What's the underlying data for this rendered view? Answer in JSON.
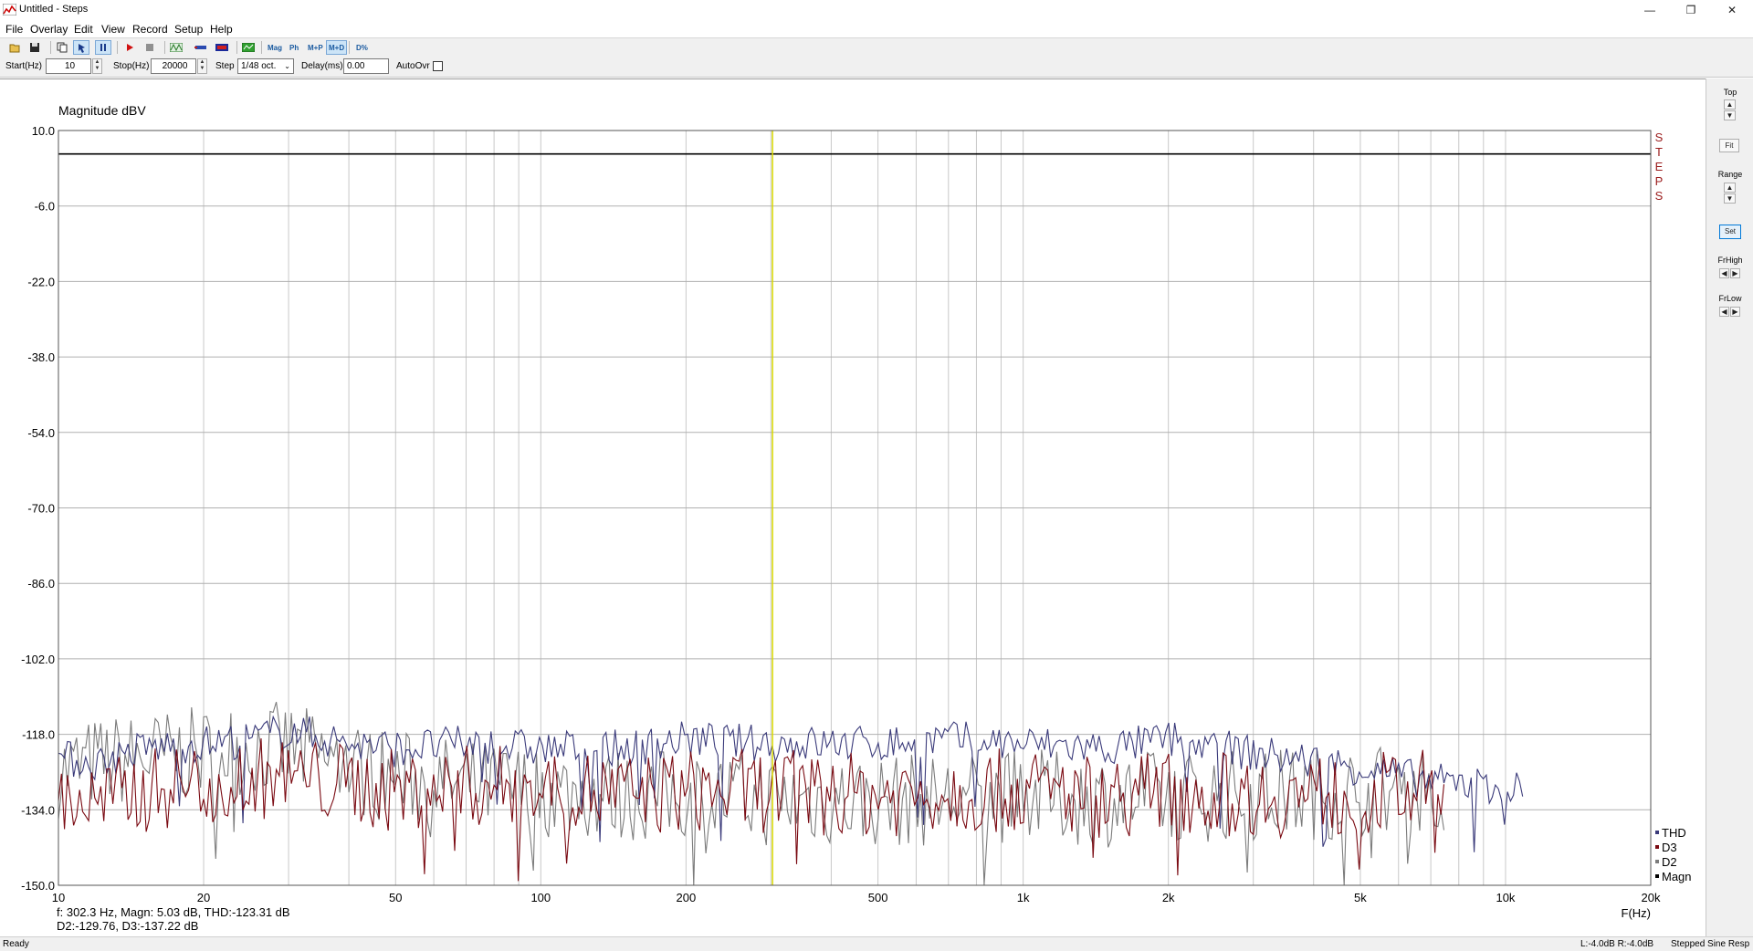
{
  "window": {
    "title": "Untitled - Steps",
    "minimize": "—",
    "restore": "❐",
    "close": "✕"
  },
  "menu": [
    "File",
    "Overlay",
    "Edit",
    "View",
    "Record",
    "Setup",
    "Help"
  ],
  "toolbar": {
    "buttons": [
      "open-icon",
      "save-icon",
      "copy-icon",
      "cursor-icon",
      "pause-icon",
      "play-icon",
      "stop-icon",
      "sweep-icon",
      "loop-icon",
      "generator-icon",
      "spectrum-icon"
    ],
    "mode_buttons": [
      "Mag",
      "Ph",
      "M+P",
      "M+D",
      "D%"
    ],
    "active_mode": "M+D"
  },
  "controls": {
    "start_label": "Start(Hz)",
    "start_value": "10",
    "stop_label": "Stop(Hz)",
    "stop_value": "20000",
    "step_label": "Step",
    "step_value": "1/48 oct.",
    "delay_label": "Delay(ms)",
    "delay_value": "0.00",
    "autoovr_label": "AutoOvr"
  },
  "right_panel": {
    "top_label": "Top",
    "fit_label": "Fit",
    "range_label": "Range",
    "set_label": "Set",
    "frhigh_label": "FrHigh",
    "frlow_label": "FrLow",
    "up": "▲",
    "down": "▼",
    "left": "◀",
    "right": "▶"
  },
  "readout": {
    "line1": "f:  302.3 Hz, Magn: 5.03 dB, THD:-123.31  dB",
    "line2": "D2:-129.76, D3:-137.22 dB"
  },
  "status": {
    "left": "Ready",
    "levels": "L:-4.0dB  R:-4.0dB",
    "mode": "Stepped Sine Resp"
  },
  "colors": {
    "thd": "#3a3a7a",
    "d3": "#7a0a12",
    "d2": "#7c7c7c",
    "magn": "#000000",
    "cursor": "#d8d800",
    "grid": "#c8c8c8",
    "logo": "#9a1a1a"
  },
  "chart_data": {
    "type": "line",
    "ylabel": "Magnitude dBV",
    "xlabel": "F(Hz)",
    "logo": [
      "S",
      "T",
      "E",
      "P",
      "S"
    ],
    "xscale": "log",
    "xlim": [
      10,
      20000
    ],
    "ylim": [
      -150,
      10
    ],
    "y_ticks": [
      "10.0",
      "-6.0",
      "-22.0",
      "-38.0",
      "-54.0",
      "-70.0",
      "-86.0",
      "-102.0",
      "-118.0",
      "-134.0",
      "-150.0"
    ],
    "y_tick_values": [
      10,
      -6,
      -22,
      -38,
      -54,
      -70,
      -86,
      -102,
      -118,
      -134,
      -150
    ],
    "x_ticks": [
      {
        "v": 10,
        "l": "10"
      },
      {
        "v": 20,
        "l": "20"
      },
      {
        "v": 50,
        "l": "50"
      },
      {
        "v": 100,
        "l": "100"
      },
      {
        "v": 200,
        "l": "200"
      },
      {
        "v": 500,
        "l": "500"
      },
      {
        "v": 1000,
        "l": "1k"
      },
      {
        "v": 2000,
        "l": "2k"
      },
      {
        "v": 5000,
        "l": "5k"
      },
      {
        "v": 10000,
        "l": "10k"
      },
      {
        "v": 20000,
        "l": "20k"
      }
    ],
    "cursor_hz": 302.3,
    "grid": true,
    "legend_position": "bottom-right",
    "series": [
      {
        "name": "THD",
        "color": "#3a3a7a",
        "x": [
          10,
          12,
          15,
          20,
          25,
          30,
          40,
          50,
          70,
          100,
          150,
          200,
          300,
          500,
          700,
          1000,
          1500,
          2000,
          3000,
          5000,
          7000,
          10000,
          10800
        ],
        "y": [
          -123,
          -124,
          -121,
          -120,
          -119,
          -117,
          -120,
          -121,
          -120,
          -121,
          -121,
          -119,
          -120,
          -120,
          -119,
          -120,
          -121,
          -119,
          -122,
          -125,
          -128,
          -129,
          -130
        ]
      },
      {
        "name": "D3",
        "color": "#7a0a12",
        "x": [
          10,
          12,
          15,
          20,
          30,
          50,
          70,
          100,
          150,
          200,
          300,
          500,
          700,
          1000,
          1500,
          2000,
          3000,
          5000,
          7000,
          7500
        ],
        "y": [
          -131,
          -133,
          -130,
          -128,
          -127,
          -130,
          -129,
          -129,
          -131,
          -130,
          -130,
          -131,
          -130,
          -130,
          -131,
          -130,
          -131,
          -131,
          -130,
          -130
        ]
      },
      {
        "name": "D2",
        "color": "#7c7c7c",
        "x": [
          10,
          12,
          15,
          20,
          25,
          30,
          40,
          50,
          70,
          100,
          150,
          200,
          300,
          500,
          700,
          1000,
          1500,
          2000,
          3000,
          5000,
          7000,
          7500
        ],
        "y": [
          -126,
          -124,
          -123,
          -122,
          -121,
          -121,
          -125,
          -127,
          -129,
          -130,
          -131,
          -131,
          -132,
          -132,
          -132,
          -131,
          -132,
          -131,
          -131,
          -130,
          -129,
          -129
        ]
      },
      {
        "name": "Magn",
        "color": "#000000",
        "x": [
          10,
          20000
        ],
        "y": [
          5.03,
          5.03
        ]
      }
    ]
  }
}
